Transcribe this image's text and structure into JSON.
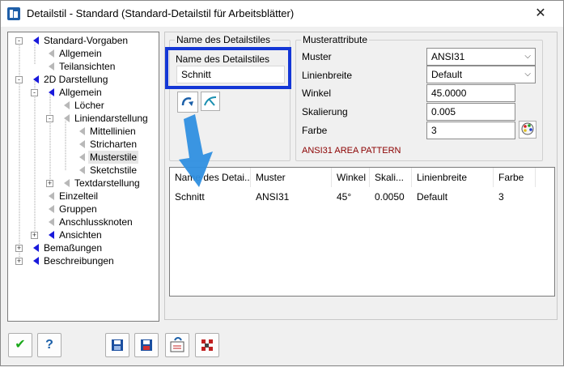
{
  "window": {
    "title": "Detailstil - Standard (Standard-Detailstil für Arbeitsblätter)",
    "close_glyph": "✕"
  },
  "tree": {
    "items": [
      {
        "label": "Standard-Vorgaben",
        "icon": "blue-arrow-icon",
        "expander": "-"
      },
      {
        "label": "Allgemein",
        "icon": "gray-arrow-icon"
      },
      {
        "label": "Teilansichten",
        "icon": "gray-arrow-icon"
      },
      {
        "label": "2D Darstellung",
        "icon": "blue-arrow-icon",
        "expander": "-"
      },
      {
        "label": "Allgemein",
        "icon": "blue-arrow-icon",
        "expander": "-"
      },
      {
        "label": "Löcher",
        "icon": "gray-arrow-icon"
      },
      {
        "label": "Liniendarstellung",
        "icon": "gray-arrow-icon",
        "expander": "-"
      },
      {
        "label": "Mittellinien",
        "icon": "gray-arrow-icon"
      },
      {
        "label": "Stricharten",
        "icon": "gray-arrow-icon"
      },
      {
        "label": "Musterstile",
        "icon": "gray-arrow-icon",
        "selected": true
      },
      {
        "label": "Sketchstile",
        "icon": "gray-arrow-icon"
      },
      {
        "label": "Textdarstellung",
        "icon": "gray-arrow-icon",
        "expander": "+"
      },
      {
        "label": "Einzelteil",
        "icon": "gray-arrow-icon"
      },
      {
        "label": "Gruppen",
        "icon": "gray-arrow-icon"
      },
      {
        "label": "Anschlussknoten",
        "icon": "gray-arrow-icon"
      },
      {
        "label": "Ansichten",
        "icon": "blue-arrow-icon",
        "expander": "+"
      },
      {
        "label": "Bemaßungen",
        "icon": "blue-arrow-icon",
        "expander": "+"
      },
      {
        "label": "Beschreibungen",
        "icon": "blue-arrow-icon",
        "expander": "+"
      }
    ]
  },
  "name_group": {
    "title": "Name des Detailstiles",
    "field_label": "Name des Detailstiles",
    "value": "Schnitt",
    "apply_icon": "rotate-arrow-icon",
    "clear_icon": "pattern-clear-icon"
  },
  "pattern_group": {
    "title": "Musterattribute",
    "muster_label": "Muster",
    "muster_value": "ANSI31",
    "linienbreite_label": "Linienbreite",
    "linienbreite_value": "Default",
    "winkel_label": "Winkel",
    "winkel_value": "45.0000",
    "skalierung_label": "Skalierung",
    "skalierung_value": "0.005",
    "farbe_label": "Farbe",
    "farbe_value": "3",
    "color_picker_icon": "palette-icon",
    "pattern_description": "ANSI31 AREA PATTERN"
  },
  "list": {
    "columns": [
      "Name des Detai...",
      "Muster",
      "Winkel",
      "Skali...",
      "Linienbreite",
      "Farbe"
    ],
    "rows": [
      [
        "Schnitt",
        "ANSI31",
        "45°",
        "0.0050",
        "Default",
        "3"
      ]
    ]
  },
  "bottom_buttons": [
    {
      "icon": "checkmark-icon",
      "glyph": "✔"
    },
    {
      "icon": "help-icon",
      "glyph": "?"
    },
    {
      "icon": "save-icon",
      "glyph": "💾"
    },
    {
      "icon": "save-as-icon",
      "glyph": "💾"
    },
    {
      "icon": "export-icon",
      "glyph": "⇄"
    },
    {
      "icon": "grid-icon",
      "glyph": "▦"
    }
  ],
  "colors": {
    "highlight": "#1437d6",
    "overlay_arrow": "#2f8fe0",
    "pattern_desc": "#8b0000",
    "tree_blue": "#1a1adb"
  }
}
